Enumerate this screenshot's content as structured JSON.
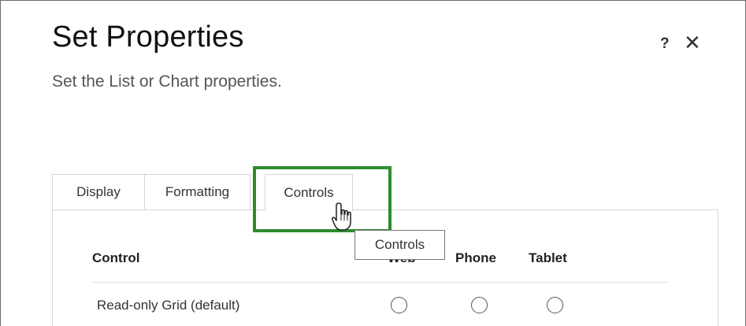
{
  "dialog": {
    "title": "Set Properties",
    "subtitle": "Set the List or Chart properties.",
    "help_label": "?",
    "close_label": "✕"
  },
  "tabs": [
    {
      "label": "Display",
      "selected": false
    },
    {
      "label": "Formatting",
      "selected": false
    },
    {
      "label": "Controls",
      "selected": true
    }
  ],
  "tooltip": "Controls",
  "table": {
    "headers": [
      "Control",
      "Web",
      "Phone",
      "Tablet"
    ],
    "rows": [
      {
        "label": "Read-only Grid (default)",
        "web": false,
        "phone": false,
        "tablet": false
      }
    ]
  },
  "colors": {
    "highlight": "#2e8b2e",
    "border": "#d6d6d6"
  },
  "icons": [
    "help-icon",
    "close-icon",
    "hand-pointer-icon"
  ]
}
